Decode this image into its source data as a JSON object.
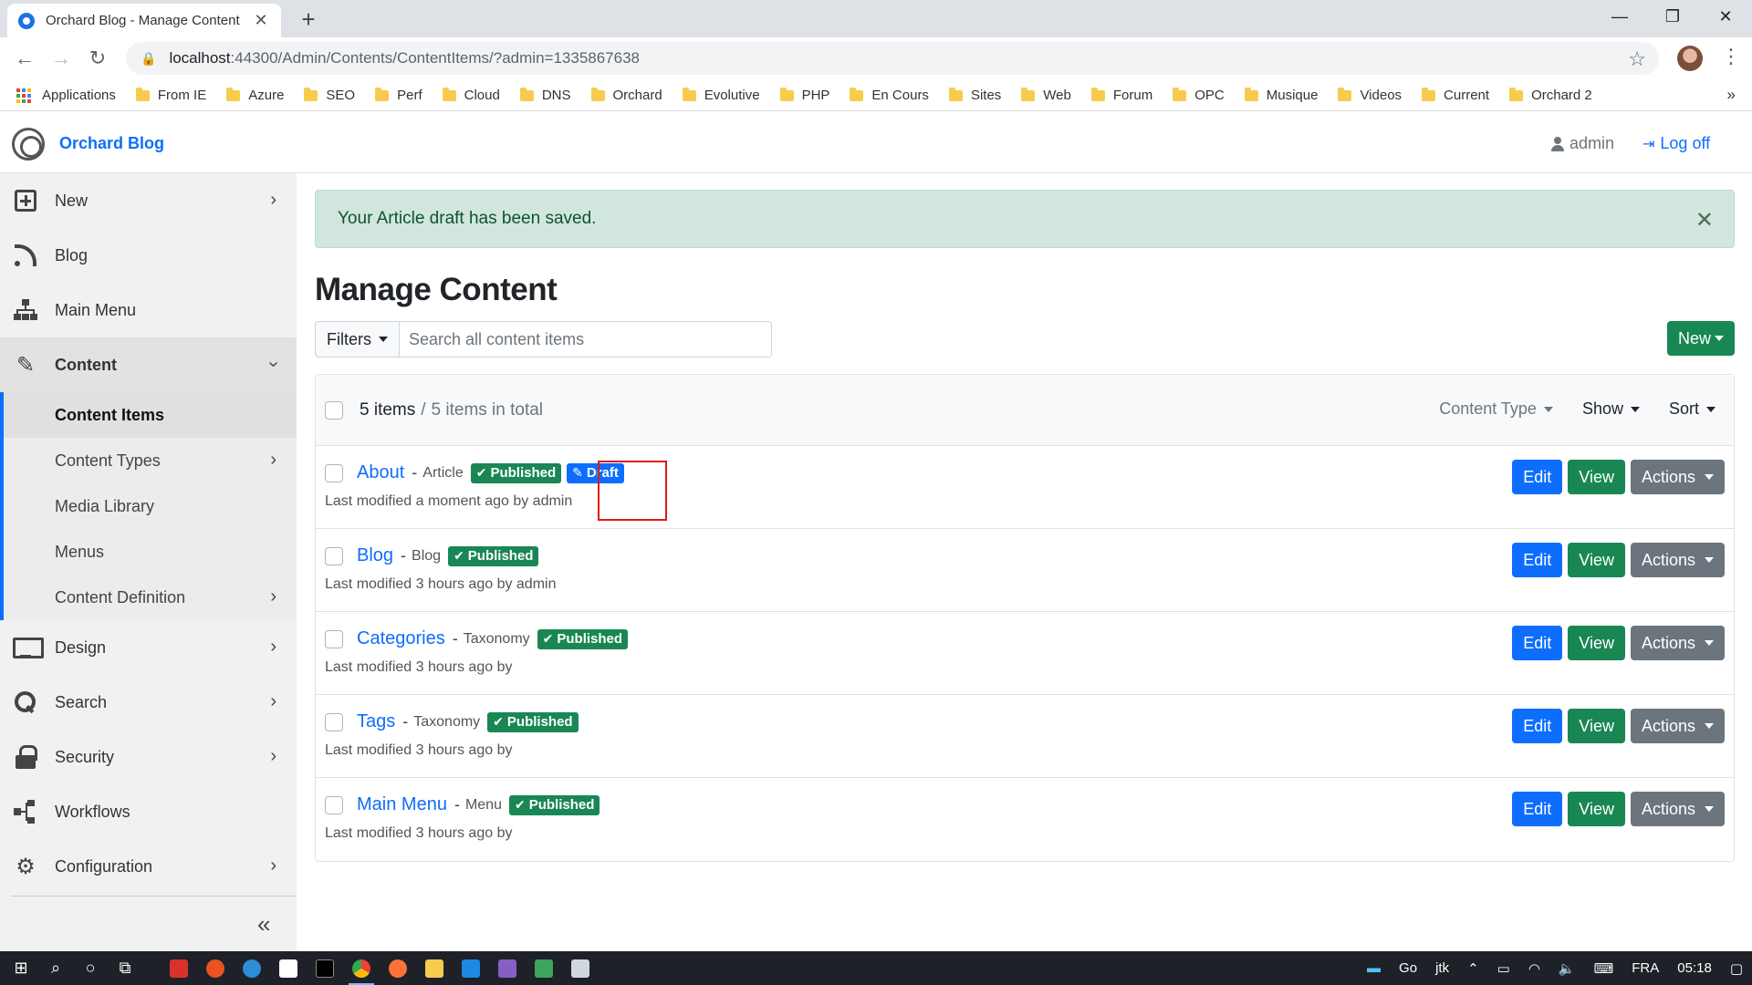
{
  "browser": {
    "tab_title": "Orchard Blog - Manage Content",
    "url_host": "localhost",
    "url_path": ":44300/Admin/Contents/ContentItems/?admin=1335867638",
    "bookmarks": [
      "Applications",
      "From IE",
      "Azure",
      "SEO",
      "Perf",
      "Cloud",
      "DNS",
      "Orchard",
      "Evolutive",
      "PHP",
      "En Cours",
      "Sites",
      "Web",
      "Forum",
      "OPC",
      "Musique",
      "Videos",
      "Current",
      "Orchard 2"
    ]
  },
  "header": {
    "brand": "Orchard Blog",
    "user": "admin",
    "logoff": "Log off"
  },
  "sidebar": {
    "items": [
      {
        "label": "New",
        "icon": "plus-square-icon"
      },
      {
        "label": "Blog",
        "icon": "rss-icon"
      },
      {
        "label": "Main Menu",
        "icon": "sitemap-icon"
      },
      {
        "label": "Content",
        "icon": "edit-icon"
      },
      {
        "label": "Design",
        "icon": "monitor-icon"
      },
      {
        "label": "Search",
        "icon": "search-icon"
      },
      {
        "label": "Security",
        "icon": "lock-icon"
      },
      {
        "label": "Workflows",
        "icon": "workflow-icon"
      },
      {
        "label": "Configuration",
        "icon": "gear-icon"
      }
    ],
    "content_sub": [
      "Content Items",
      "Content Types",
      "Media Library",
      "Menus",
      "Content Definition"
    ]
  },
  "alert": {
    "message": "Your Article draft has been saved."
  },
  "page": {
    "title": "Manage Content",
    "filters_label": "Filters",
    "search_placeholder": "Search all content items",
    "new_label": "New"
  },
  "list": {
    "count": "5 items",
    "sep": "/",
    "total": "5 items in total",
    "content_type_label": "Content Type",
    "show_label": "Show",
    "sort_label": "Sort",
    "edit_label": "Edit",
    "view_label": "View",
    "actions_label": "Actions",
    "published_label": "Published",
    "draft_label": "Draft",
    "items": [
      {
        "title": "About",
        "type": "Article",
        "modified": "Last modified a moment ago by admin"
      },
      {
        "title": "Blog",
        "type": "Blog",
        "modified": "Last modified 3 hours ago by admin"
      },
      {
        "title": "Categories",
        "type": "Taxonomy",
        "modified": "Last modified 3 hours ago by"
      },
      {
        "title": "Tags",
        "type": "Taxonomy",
        "modified": "Last modified 3 hours ago by"
      },
      {
        "title": "Main Menu",
        "type": "Menu",
        "modified": "Last modified 3 hours ago by"
      }
    ]
  },
  "taskbar": {
    "tray": [
      "Go",
      "jtk",
      "FRA",
      "05:18"
    ]
  },
  "colors": {
    "primary": "#0d6efd",
    "success": "#198754",
    "secondary": "#6c757d",
    "alert_bg": "#d1e7dd",
    "highlight": "#e0191b"
  }
}
